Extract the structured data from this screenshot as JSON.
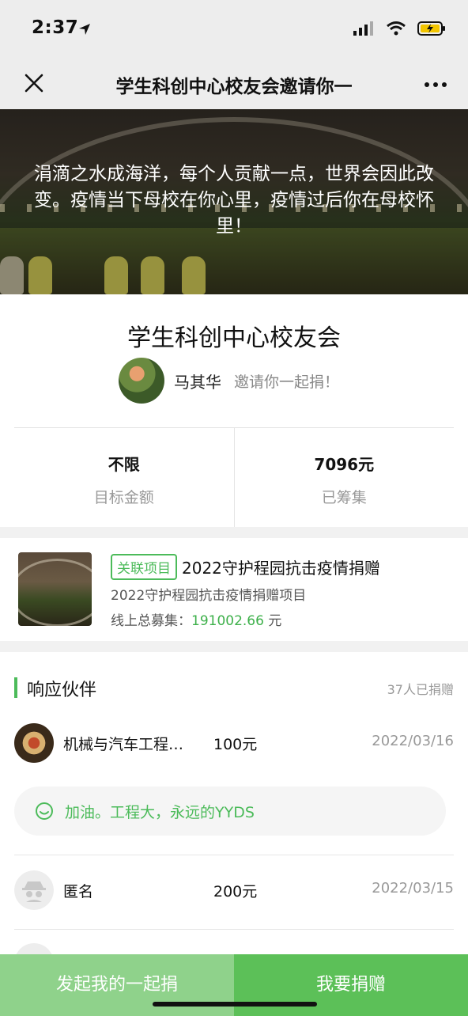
{
  "status_bar": {
    "time": "2:37"
  },
  "nav": {
    "title": "学生科创中心校友会邀请你一"
  },
  "banner": {
    "text": "涓滴之水成海洋，每个人贡献一点，世界会因此改变。疫情当下母校在你心里，疫情过后你在母校怀里！"
  },
  "org": {
    "name": "学生科创中心校友会"
  },
  "inviter": {
    "name": "马其华",
    "text": "邀请你一起捐！"
  },
  "stats": {
    "target_value": "不限",
    "target_label": "目标金额",
    "raised_value": "7096元",
    "raised_label": "已筹集"
  },
  "project": {
    "tag": "关联项目",
    "name": "2022守护程园抗击疫情捐赠",
    "desc": "2022守护程园抗击疫情捐赠项目",
    "total_label": "线上总募集：",
    "total_amount": "191002.66",
    "total_unit": " 元"
  },
  "partners": {
    "title": "响应伙伴",
    "count": "37人已捐赠",
    "donors": [
      {
        "name": "机械与汽车工程…",
        "amount": "100元",
        "date": "2022/03/16"
      },
      {
        "name": "匿名",
        "amount": "200元",
        "date": "2022/03/15"
      }
    ],
    "comment": "加油。工程大，永远的YYDS"
  },
  "footer": {
    "start_label": "发起我的一起捐",
    "donate_label": "我要捐赠"
  },
  "colors": {
    "accent": "#4cbb5a",
    "button_light": "#8fd28b",
    "button_dark": "#5cc058"
  }
}
